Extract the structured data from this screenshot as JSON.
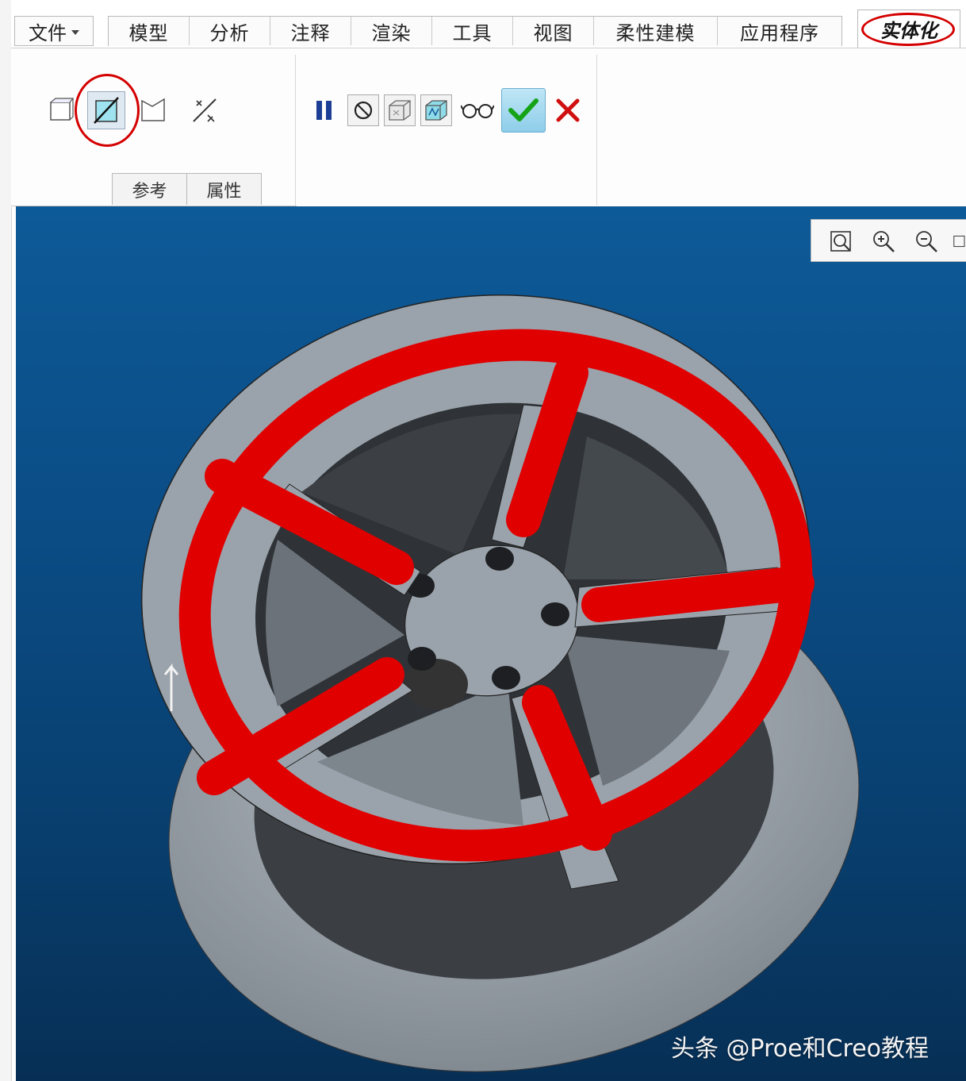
{
  "menu": {
    "file_label": "文件",
    "tabs": [
      {
        "label": "模型",
        "width": 102
      },
      {
        "label": "分析",
        "width": 102
      },
      {
        "label": "注释",
        "width": 102
      },
      {
        "label": "渲染",
        "width": 102
      },
      {
        "label": "工具",
        "width": 102
      },
      {
        "label": "视图",
        "width": 102
      },
      {
        "label": "柔性建模",
        "width": 156
      },
      {
        "label": "应用程序",
        "width": 156
      }
    ],
    "active_tab_label": "实体化"
  },
  "ribbon": {
    "subtabs": [
      "参考",
      "属性"
    ],
    "highlighted_tool": "remove-material-icon"
  },
  "viewport": {
    "toolbar_icons": [
      "refit-icon",
      "zoom-in-icon",
      "zoom-out-icon",
      "repaint-icon"
    ],
    "background": "#0b4d86",
    "highlight_color": "#e00000",
    "model_color": "#9aa3ab"
  },
  "watermark": "头条 @Proe和Creo教程"
}
